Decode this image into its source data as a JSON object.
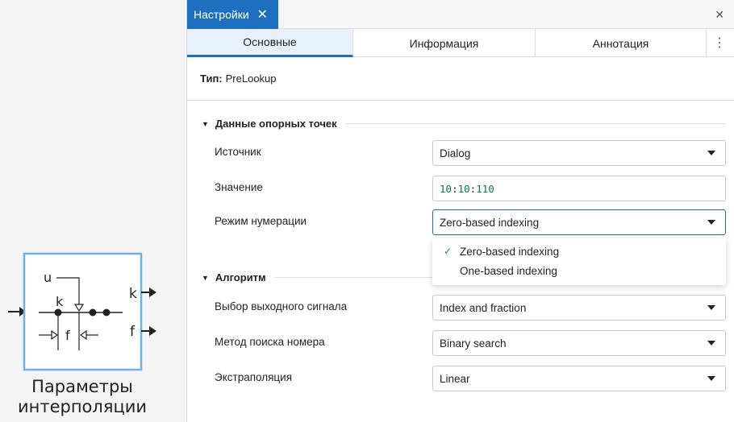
{
  "canvas": {
    "block": {
      "port_u": "u",
      "port_k_in": "k",
      "port_f_in": "f",
      "out_k": "k",
      "out_f": "f"
    },
    "caption_line1": "Параметры",
    "caption_line2": "интерполяции"
  },
  "panel": {
    "title_tab": "Настройки",
    "tabs": [
      "Основные",
      "Информация",
      "Аннотация"
    ],
    "active_tab": "Основные",
    "type_label": "Тип:",
    "type_value": "PreLookup"
  },
  "sections": {
    "breakpoints": {
      "title": "Данные опорных точек",
      "source_label": "Источник",
      "source_value": "Dialog",
      "value_label": "Значение",
      "value_parts": [
        "10",
        ":",
        "10",
        ":",
        "110"
      ],
      "indexing_label": "Режим нумерации",
      "indexing_value": "Zero-based indexing",
      "indexing_options": [
        "Zero-based indexing",
        "One-based indexing"
      ]
    },
    "algorithm": {
      "title": "Алгоритм",
      "output_label": "Выбор выходного сигнала",
      "output_value": "Index and fraction",
      "search_label": "Метод поиска номера",
      "search_value": "Binary search",
      "extrap_label": "Экстраполяция",
      "extrap_value": "Linear"
    }
  },
  "colors": {
    "accent": "#1e6fbf",
    "number": "#0a7a3e",
    "block_border": "#6fb0e6"
  }
}
